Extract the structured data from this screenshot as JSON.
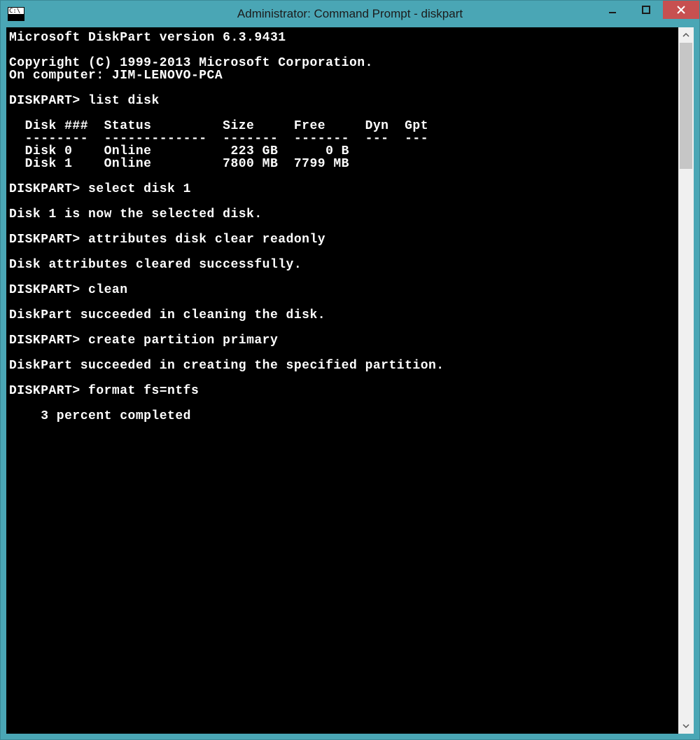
{
  "window": {
    "title": "Administrator: Command Prompt - diskpart"
  },
  "terminal": {
    "version_line": "Microsoft DiskPart version 6.3.9431",
    "copyright_line": "Copyright (C) 1999-2013 Microsoft Corporation.",
    "computer_line": "On computer: JIM-LENOVO-PCA",
    "prompt": "DISKPART>",
    "cmd_list_disk": "list disk",
    "table": {
      "header": "  Disk ###  Status         Size     Free     Dyn  Gpt",
      "divider": "  --------  -------------  -------  -------  ---  ---",
      "rows": [
        "  Disk 0    Online          223 GB      0 B",
        "  Disk 1    Online         7800 MB  7799 MB"
      ]
    },
    "cmd_select": "select disk 1",
    "resp_select": "Disk 1 is now the selected disk.",
    "cmd_attr": "attributes disk clear readonly",
    "resp_attr": "Disk attributes cleared successfully.",
    "cmd_clean": "clean",
    "resp_clean": "DiskPart succeeded in cleaning the disk.",
    "cmd_create": "create partition primary",
    "resp_create": "DiskPart succeeded in creating the specified partition.",
    "cmd_format": "format fs=ntfs",
    "progress": "    3 percent completed"
  }
}
